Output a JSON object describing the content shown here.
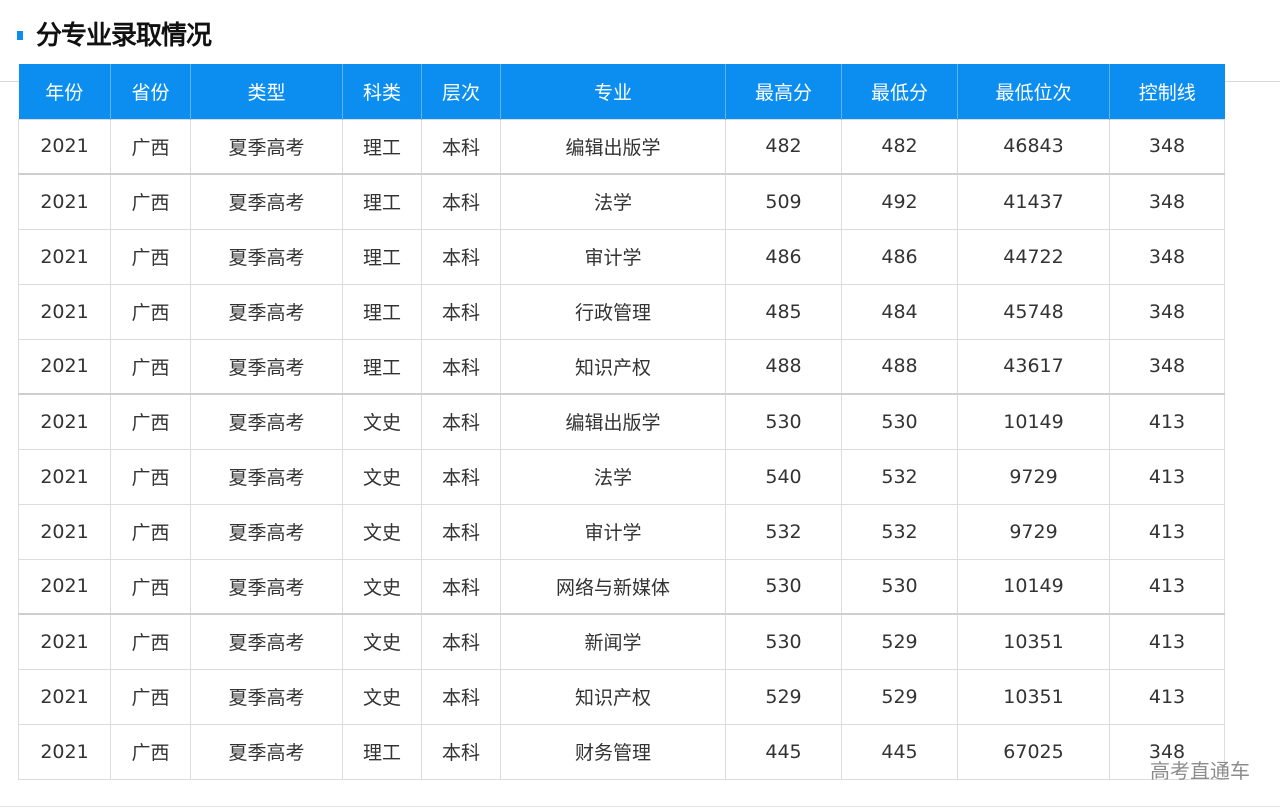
{
  "section": {
    "title": "分专业录取情况"
  },
  "table": {
    "headers": [
      "年份",
      "省份",
      "类型",
      "科类",
      "层次",
      "专业",
      "最高分",
      "最低分",
      "最低位次",
      "控制线"
    ],
    "rows": [
      [
        "2021",
        "广西",
        "夏季高考",
        "理工",
        "本科",
        "编辑出版学",
        "482",
        "482",
        "46843",
        "348"
      ],
      [
        "2021",
        "广西",
        "夏季高考",
        "理工",
        "本科",
        "法学",
        "509",
        "492",
        "41437",
        "348"
      ],
      [
        "2021",
        "广西",
        "夏季高考",
        "理工",
        "本科",
        "审计学",
        "486",
        "486",
        "44722",
        "348"
      ],
      [
        "2021",
        "广西",
        "夏季高考",
        "理工",
        "本科",
        "行政管理",
        "485",
        "484",
        "45748",
        "348"
      ],
      [
        "2021",
        "广西",
        "夏季高考",
        "理工",
        "本科",
        "知识产权",
        "488",
        "488",
        "43617",
        "348"
      ],
      [
        "2021",
        "广西",
        "夏季高考",
        "文史",
        "本科",
        "编辑出版学",
        "530",
        "530",
        "10149",
        "413"
      ],
      [
        "2021",
        "广西",
        "夏季高考",
        "文史",
        "本科",
        "法学",
        "540",
        "532",
        "9729",
        "413"
      ],
      [
        "2021",
        "广西",
        "夏季高考",
        "文史",
        "本科",
        "审计学",
        "532",
        "532",
        "9729",
        "413"
      ],
      [
        "2021",
        "广西",
        "夏季高考",
        "文史",
        "本科",
        "网络与新媒体",
        "530",
        "530",
        "10149",
        "413"
      ],
      [
        "2021",
        "广西",
        "夏季高考",
        "文史",
        "本科",
        "新闻学",
        "530",
        "529",
        "10351",
        "413"
      ],
      [
        "2021",
        "广西",
        "夏季高考",
        "文史",
        "本科",
        "知识产权",
        "529",
        "529",
        "10351",
        "413"
      ],
      [
        "2021",
        "广西",
        "夏季高考",
        "理工",
        "本科",
        "财务管理",
        "445",
        "445",
        "67025",
        "348"
      ]
    ]
  },
  "watermark": "高考直通车",
  "colors": {
    "accent": "#0b8ef0",
    "header_text": "#ffffff",
    "cell_text": "#333333"
  }
}
